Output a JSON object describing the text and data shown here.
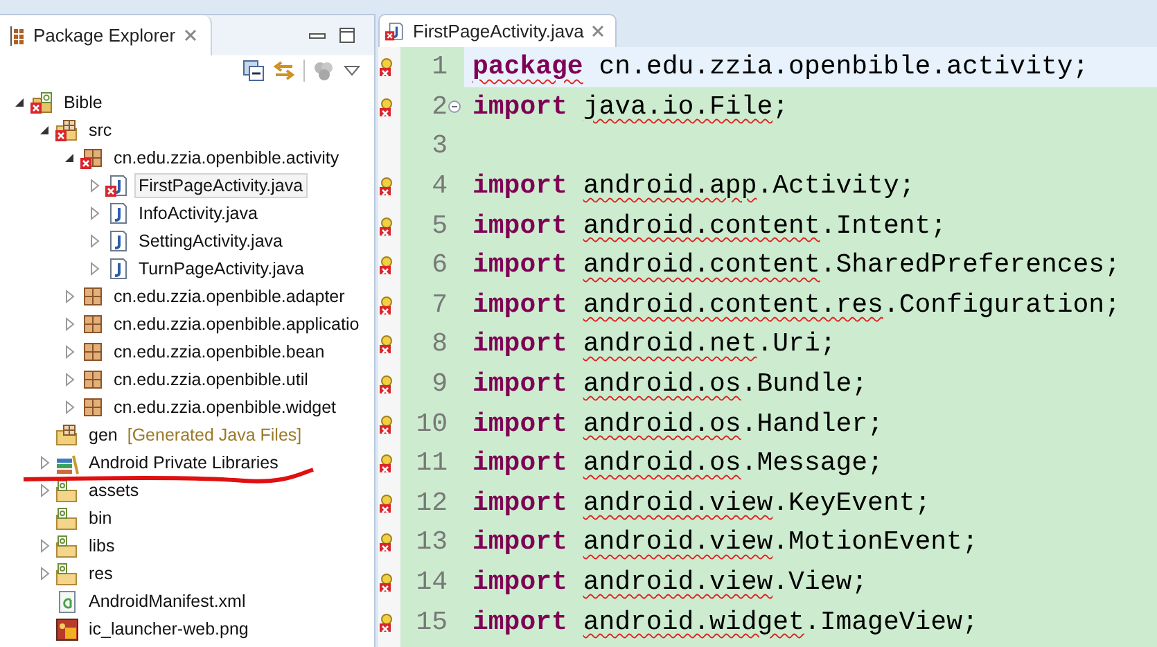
{
  "explorer": {
    "title": "Package Explorer",
    "tree": [
      {
        "label": "Bible",
        "kind": "project",
        "error": true,
        "expanded": true,
        "children": [
          {
            "label": "src",
            "kind": "source-folder",
            "error": true,
            "expanded": true,
            "children": [
              {
                "label": "cn.edu.zzia.openbible.activity",
                "kind": "package",
                "error": true,
                "expanded": true,
                "children": [
                  {
                    "label": "FirstPageActivity.java",
                    "kind": "java",
                    "error": true,
                    "expanded": false,
                    "selected": true
                  },
                  {
                    "label": "InfoActivity.java",
                    "kind": "java",
                    "error": false,
                    "expanded": false,
                    "selected": false
                  },
                  {
                    "label": "SettingActivity.java",
                    "kind": "java",
                    "error": false,
                    "expanded": false,
                    "selected": false
                  },
                  {
                    "label": "TurnPageActivity.java",
                    "kind": "java",
                    "error": false,
                    "expanded": false,
                    "selected": false
                  }
                ]
              },
              {
                "label": "cn.edu.zzia.openbible.adapter",
                "kind": "package",
                "error": false,
                "expanded": false
              },
              {
                "label": "cn.edu.zzia.openbible.applicatio",
                "kind": "package",
                "error": false,
                "expanded": false
              },
              {
                "label": "cn.edu.zzia.openbible.bean",
                "kind": "package",
                "error": false,
                "expanded": false
              },
              {
                "label": "cn.edu.zzia.openbible.util",
                "kind": "package",
                "error": false,
                "expanded": false
              },
              {
                "label": "cn.edu.zzia.openbible.widget",
                "kind": "package",
                "error": false,
                "expanded": false
              }
            ]
          },
          {
            "label": "gen",
            "suffix": "[Generated Java Files]",
            "kind": "source-folder",
            "error": false
          },
          {
            "label": "Android Private Libraries",
            "kind": "library",
            "error": false,
            "expanded": false
          },
          {
            "label": "assets",
            "kind": "folder",
            "error": false,
            "expanded": false
          },
          {
            "label": "bin",
            "kind": "folder",
            "error": false
          },
          {
            "label": "libs",
            "kind": "folder",
            "error": false,
            "expanded": false
          },
          {
            "label": "res",
            "kind": "folder",
            "error": false,
            "expanded": false
          },
          {
            "label": "AndroidManifest.xml",
            "kind": "xml",
            "error": false
          },
          {
            "label": "ic_launcher-web.png",
            "kind": "image",
            "error": false
          }
        ]
      }
    ]
  },
  "editor": {
    "tab": {
      "label": "FirstPageActivity.java",
      "error": true
    },
    "lines": [
      {
        "number": "1",
        "marker": true,
        "current": true,
        "segments": [
          {
            "text": "package",
            "kind": "keyword",
            "error": true
          },
          {
            "text": "cn.edu.zzia.openbible.activity;",
            "kind": "plain",
            "error": false
          }
        ]
      },
      {
        "number": "2",
        "marker": true,
        "current": false,
        "fold": true,
        "segments": [
          {
            "text": "import",
            "kind": "keyword",
            "error": false
          },
          {
            "text": "java.io.File",
            "kind": "plain",
            "error": true
          },
          {
            "text": ";",
            "kind": "plain",
            "error": false
          }
        ]
      },
      {
        "number": "3",
        "marker": false,
        "current": false
      },
      {
        "number": "4",
        "marker": true,
        "current": false,
        "segments": [
          {
            "text": "import",
            "kind": "keyword",
            "error": false
          },
          {
            "text": "android.app",
            "kind": "plain",
            "error": true
          },
          {
            "text": ".Activity;",
            "kind": "plain",
            "error": false
          }
        ]
      },
      {
        "number": "5",
        "marker": true,
        "current": false,
        "segments": [
          {
            "text": "import",
            "kind": "keyword",
            "error": false
          },
          {
            "text": "android.content",
            "kind": "plain",
            "error": true
          },
          {
            "text": ".Intent;",
            "kind": "plain",
            "error": false
          }
        ]
      },
      {
        "number": "6",
        "marker": true,
        "current": false,
        "segments": [
          {
            "text": "import",
            "kind": "keyword",
            "error": false
          },
          {
            "text": "android.content",
            "kind": "plain",
            "error": true
          },
          {
            "text": ".SharedPreferences;",
            "kind": "plain",
            "error": false
          }
        ]
      },
      {
        "number": "7",
        "marker": true,
        "current": false,
        "segments": [
          {
            "text": "import",
            "kind": "keyword",
            "error": false
          },
          {
            "text": "android.content.res",
            "kind": "plain",
            "error": true
          },
          {
            "text": ".Configuration;",
            "kind": "plain",
            "error": false
          }
        ]
      },
      {
        "number": "8",
        "marker": true,
        "current": false,
        "segments": [
          {
            "text": "import",
            "kind": "keyword",
            "error": false
          },
          {
            "text": "android.net",
            "kind": "plain",
            "error": true
          },
          {
            "text": ".Uri;",
            "kind": "plain",
            "error": false
          }
        ]
      },
      {
        "number": "9",
        "marker": true,
        "current": false,
        "segments": [
          {
            "text": "import",
            "kind": "keyword",
            "error": false
          },
          {
            "text": "android.os",
            "kind": "plain",
            "error": true
          },
          {
            "text": ".Bundle;",
            "kind": "plain",
            "error": false
          }
        ]
      },
      {
        "number": "10",
        "marker": true,
        "current": false,
        "segments": [
          {
            "text": "import",
            "kind": "keyword",
            "error": false
          },
          {
            "text": "android.os",
            "kind": "plain",
            "error": true
          },
          {
            "text": ".Handler;",
            "kind": "plain",
            "error": false
          }
        ]
      },
      {
        "number": "11",
        "marker": true,
        "current": false,
        "segments": [
          {
            "text": "import",
            "kind": "keyword",
            "error": false
          },
          {
            "text": "android.os",
            "kind": "plain",
            "error": true
          },
          {
            "text": ".Message;",
            "kind": "plain",
            "error": false
          }
        ]
      },
      {
        "number": "12",
        "marker": true,
        "current": false,
        "segments": [
          {
            "text": "import",
            "kind": "keyword",
            "error": false
          },
          {
            "text": "android.view",
            "kind": "plain",
            "error": true
          },
          {
            "text": ".KeyEvent;",
            "kind": "plain",
            "error": false
          }
        ]
      },
      {
        "number": "13",
        "marker": true,
        "current": false,
        "segments": [
          {
            "text": "import",
            "kind": "keyword",
            "error": false
          },
          {
            "text": "android.view",
            "kind": "plain",
            "error": true
          },
          {
            "text": ".MotionEvent;",
            "kind": "plain",
            "error": false
          }
        ]
      },
      {
        "number": "14",
        "marker": true,
        "current": false,
        "segments": [
          {
            "text": "import",
            "kind": "keyword",
            "error": false
          },
          {
            "text": "android.view",
            "kind": "plain",
            "error": true
          },
          {
            "text": ".View;",
            "kind": "plain",
            "error": false
          }
        ]
      },
      {
        "number": "15",
        "marker": true,
        "current": false,
        "segments": [
          {
            "text": "import",
            "kind": "keyword",
            "error": false
          },
          {
            "text": "android.widget",
            "kind": "plain",
            "error": true
          },
          {
            "text": ".ImageView;",
            "kind": "plain",
            "error": false
          }
        ]
      }
    ]
  }
}
